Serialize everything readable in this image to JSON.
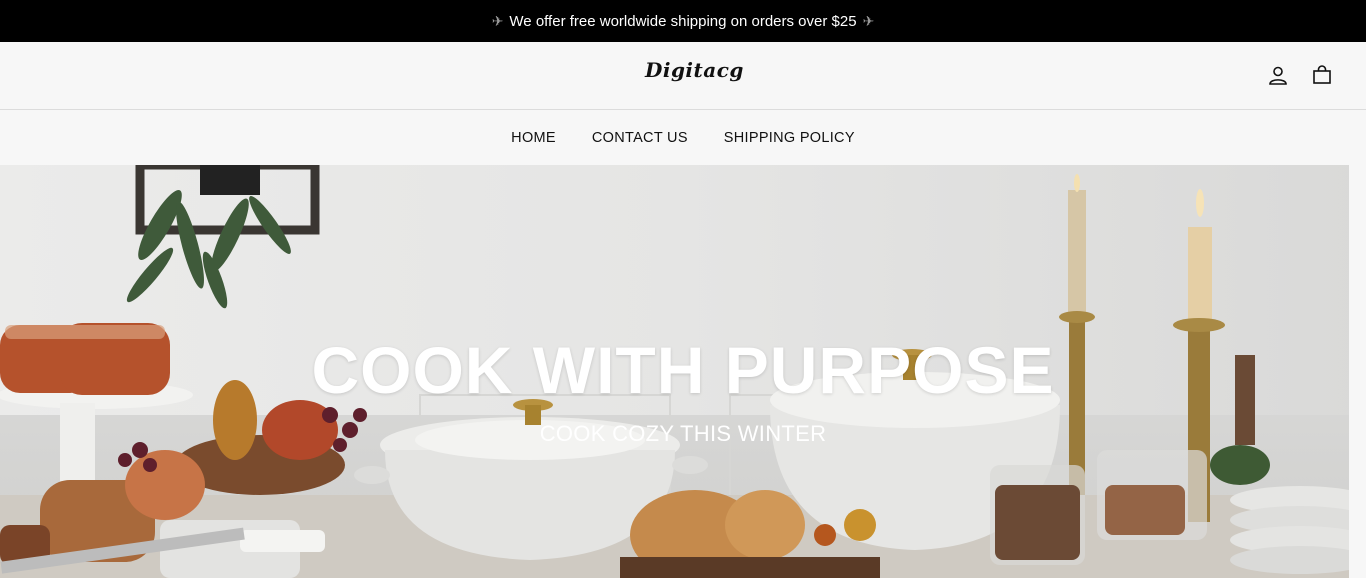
{
  "announcement": {
    "text": "We offer free worldwide shipping on orders over $25",
    "left_icon": "airplane-icon",
    "right_icon": "airplane-icon"
  },
  "header": {
    "logo": "Digitacg",
    "icons": [
      "account-icon",
      "cart-bag-icon"
    ]
  },
  "nav": {
    "items": [
      {
        "label": "HOME"
      },
      {
        "label": "CONTACT US"
      },
      {
        "label": "SHIPPING POLICY"
      }
    ]
  },
  "hero": {
    "title": "COOK WITH PURPOSE",
    "subtitle": "COOK COZY THIS WINTER"
  },
  "colors": {
    "announcement_bg": "#000000",
    "header_bg": "#f7f7f7",
    "text": "#111111",
    "hero_text": "#ffffff"
  }
}
